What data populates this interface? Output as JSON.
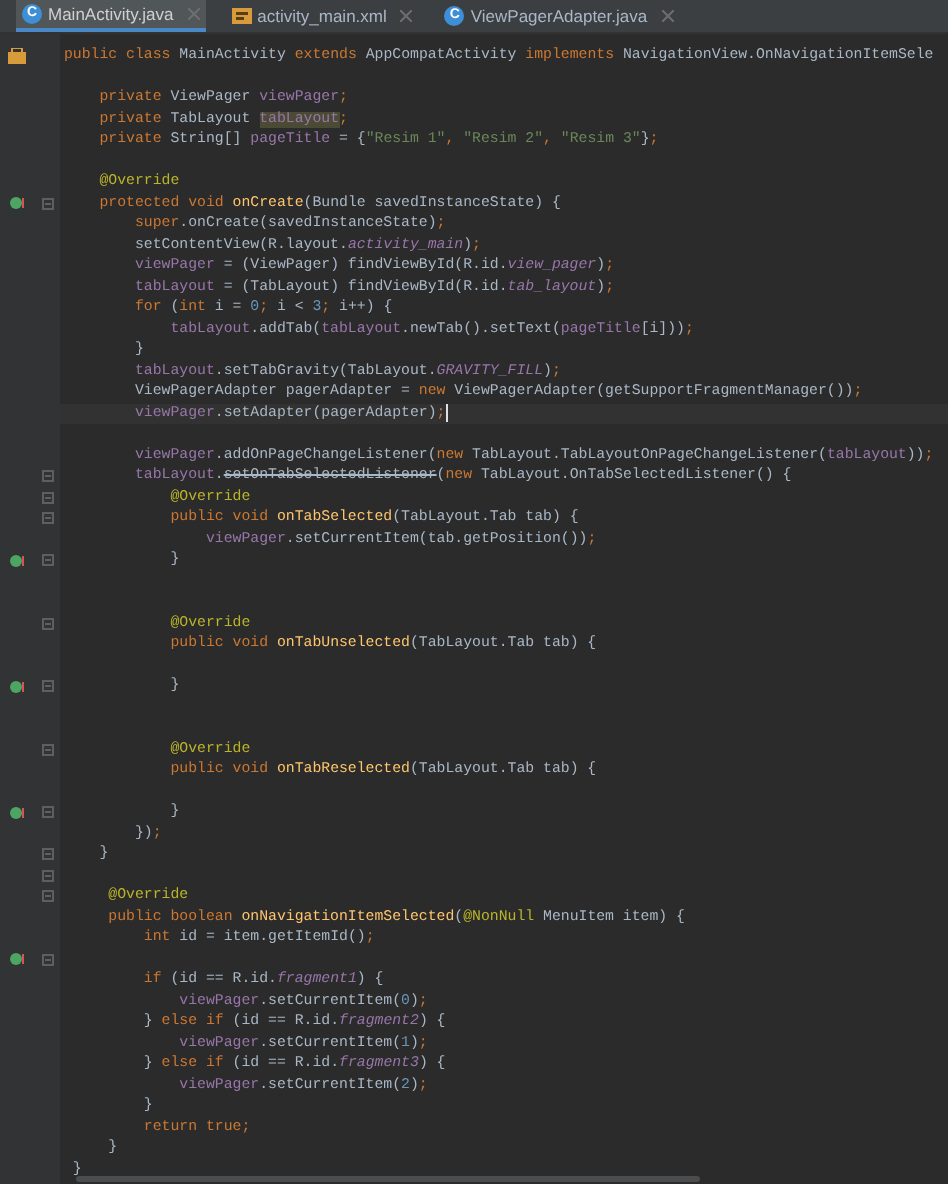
{
  "tabs": [
    {
      "label": "MainActivity.java",
      "kind": "class",
      "badge": "C",
      "selected": true
    },
    {
      "label": "activity_main.xml",
      "kind": "layout",
      "selected": false
    },
    {
      "label": "ViewPagerAdapter.java",
      "kind": "class",
      "badge": "C",
      "selected": false
    }
  ],
  "lines": [
    {
      "kind": "class",
      "tokens": [
        {
          "text": "public class ",
          "kind": "keyword"
        },
        {
          "text": "MainActivity ",
          "kind": "plain"
        },
        {
          "text": "extends ",
          "kind": "keyword"
        },
        {
          "text": "AppCompatActivity ",
          "kind": "plain"
        },
        {
          "text": "implements ",
          "kind": "keyword"
        },
        {
          "text": "NavigationView.OnNavigationItemSele",
          "kind": "plain"
        }
      ]
    },
    {
      "kind": "blank"
    },
    {
      "kind": "plain",
      "tokens": [
        {
          "text": "    private ",
          "kind": "keyword"
        },
        {
          "text": "ViewPager ",
          "kind": "plain"
        },
        {
          "text": "viewPager",
          "kind": "field"
        },
        {
          "text": ";",
          "kind": "keyword"
        }
      ]
    },
    {
      "kind": "plain",
      "tokens": [
        {
          "text": "    private ",
          "kind": "keyword"
        },
        {
          "text": "TabLayout ",
          "kind": "plain"
        },
        {
          "text": "tabLayout",
          "kind": "field_highlight"
        },
        {
          "text": ";",
          "kind": "keyword"
        }
      ]
    },
    {
      "kind": "plain",
      "tokens": [
        {
          "text": "    private ",
          "kind": "keyword"
        },
        {
          "text": "String[] ",
          "kind": "plain"
        },
        {
          "text": "pageTitle",
          "kind": "field"
        },
        {
          "text": " = {",
          "kind": "plain"
        },
        {
          "text": "\"Resim 1\"",
          "kind": "string"
        },
        {
          "text": ", ",
          "kind": "keyword"
        },
        {
          "text": "\"Resim 2\"",
          "kind": "string"
        },
        {
          "text": ", ",
          "kind": "keyword"
        },
        {
          "text": "\"Resim 3\"",
          "kind": "string"
        },
        {
          "text": "}",
          "kind": "plain"
        },
        {
          "text": ";",
          "kind": "keyword"
        }
      ]
    },
    {
      "kind": "blank"
    },
    {
      "kind": "plain",
      "tokens": [
        {
          "text": "    @Override",
          "kind": "annotation"
        }
      ]
    },
    {
      "kind": "override",
      "fold": true,
      "tokens": [
        {
          "text": "    protected void ",
          "kind": "keyword"
        },
        {
          "text": "onCreate",
          "kind": "declaration"
        },
        {
          "text": "(Bundle savedInstanceState) {",
          "kind": "plain"
        }
      ]
    },
    {
      "kind": "plain",
      "tokens": [
        {
          "text": "        super",
          "kind": "keyword"
        },
        {
          "text": ".onCreate(savedInstanceState)",
          "kind": "plain"
        },
        {
          "text": ";",
          "kind": "keyword"
        }
      ]
    },
    {
      "kind": "plain",
      "tokens": [
        {
          "text": "        setContentView(R.layout.",
          "kind": "plain"
        },
        {
          "text": "activity_main",
          "kind": "constant"
        },
        {
          "text": ")",
          "kind": "plain"
        },
        {
          "text": ";",
          "kind": "keyword"
        }
      ]
    },
    {
      "kind": "plain",
      "tokens": [
        {
          "text": "        viewPager",
          "kind": "field"
        },
        {
          "text": " = (ViewPager) findViewById(R.id.",
          "kind": "plain"
        },
        {
          "text": "view_pager",
          "kind": "constant"
        },
        {
          "text": ")",
          "kind": "plain"
        },
        {
          "text": ";",
          "kind": "keyword"
        }
      ]
    },
    {
      "kind": "plain",
      "tokens": [
        {
          "text": "        tabLayout",
          "kind": "field"
        },
        {
          "text": " = (TabLayout) findViewById(R.id.",
          "kind": "plain"
        },
        {
          "text": "tab_layout",
          "kind": "constant"
        },
        {
          "text": ")",
          "kind": "plain"
        },
        {
          "text": ";",
          "kind": "keyword"
        }
      ]
    },
    {
      "kind": "plain",
      "tokens": [
        {
          "text": "        for ",
          "kind": "keyword"
        },
        {
          "text": "(",
          "kind": "plain"
        },
        {
          "text": "int ",
          "kind": "keyword"
        },
        {
          "text": "i = ",
          "kind": "plain"
        },
        {
          "text": "0",
          "kind": "number"
        },
        {
          "text": "; ",
          "kind": "keyword"
        },
        {
          "text": "i < ",
          "kind": "plain"
        },
        {
          "text": "3",
          "kind": "number"
        },
        {
          "text": "; ",
          "kind": "keyword"
        },
        {
          "text": "i++) {",
          "kind": "plain"
        }
      ]
    },
    {
      "kind": "plain",
      "tokens": [
        {
          "text": "            tabLayout",
          "kind": "field"
        },
        {
          "text": ".addTab(",
          "kind": "plain"
        },
        {
          "text": "tabLayout",
          "kind": "field"
        },
        {
          "text": ".newTab().setText(",
          "kind": "plain"
        },
        {
          "text": "pageTitle",
          "kind": "field"
        },
        {
          "text": "[i]))",
          "kind": "plain"
        },
        {
          "text": ";",
          "kind": "keyword"
        }
      ]
    },
    {
      "kind": "plain",
      "tokens": [
        {
          "text": "        }",
          "kind": "plain"
        }
      ]
    },
    {
      "kind": "plain",
      "tokens": [
        {
          "text": "        tabLayout",
          "kind": "field"
        },
        {
          "text": ".setTabGravity(TabLayout.",
          "kind": "plain"
        },
        {
          "text": "GRAVITY_FILL",
          "kind": "constant"
        },
        {
          "text": ")",
          "kind": "plain"
        },
        {
          "text": ";",
          "kind": "keyword"
        }
      ]
    },
    {
      "kind": "plain",
      "tokens": [
        {
          "text": "        ViewPagerAdapter pagerAdapter = ",
          "kind": "plain"
        },
        {
          "text": "new ",
          "kind": "keyword"
        },
        {
          "text": "ViewPagerAdapter(getSupportFragmentManager())",
          "kind": "plain"
        },
        {
          "text": ";",
          "kind": "keyword"
        }
      ]
    },
    {
      "kind": "plain",
      "current": true,
      "tokens": [
        {
          "text": "        viewPager",
          "kind": "field"
        },
        {
          "text": ".setAdapter(pagerAdapter)",
          "kind": "plain"
        },
        {
          "text": ";",
          "kind": "keyword"
        }
      ]
    },
    {
      "kind": "blank"
    },
    {
      "kind": "plain",
      "tokens": [
        {
          "text": "        viewPager",
          "kind": "field"
        },
        {
          "text": ".addOnPageChangeListener(",
          "kind": "plain"
        },
        {
          "text": "new ",
          "kind": "keyword"
        },
        {
          "text": "TabLayout.TabLayoutOnPageChangeListener(",
          "kind": "plain"
        },
        {
          "text": "tabLayout",
          "kind": "field"
        },
        {
          "text": "))",
          "kind": "plain"
        },
        {
          "text": ";",
          "kind": "keyword"
        }
      ]
    },
    {
      "kind": "plain",
      "fold": true,
      "tokens": [
        {
          "text": "        tabLayout",
          "kind": "field"
        },
        {
          "text": ".",
          "kind": "plain"
        },
        {
          "text": "setOnTabSelectedListener",
          "kind": "deprecated"
        },
        {
          "text": "(",
          "kind": "plain"
        },
        {
          "text": "new ",
          "kind": "keyword"
        },
        {
          "text": "TabLayout.OnTabSelectedListener() {",
          "kind": "plain"
        }
      ]
    },
    {
      "kind": "plain",
      "fold": true,
      "tokens": [
        {
          "text": "            @Override",
          "kind": "annotation"
        }
      ]
    },
    {
      "kind": "plain",
      "fold": true,
      "tokens": [
        {
          "text": "            public void ",
          "kind": "keyword"
        },
        {
          "text": "onTabSelected",
          "kind": "declaration"
        },
        {
          "text": "(TabLayout.Tab tab) {",
          "kind": "plain"
        }
      ]
    },
    {
      "kind": "plain",
      "tokens": [
        {
          "text": "                viewPager",
          "kind": "field"
        },
        {
          "text": ".setCurrentItem(tab.getPosition())",
          "kind": "plain"
        },
        {
          "text": ";",
          "kind": "keyword"
        }
      ]
    },
    {
      "kind": "override",
      "fold": true,
      "tokens": [
        {
          "text": "            }",
          "kind": "plain"
        }
      ]
    },
    {
      "kind": "blank"
    },
    {
      "kind": "blank"
    },
    {
      "kind": "plain",
      "fold": true,
      "tokens": [
        {
          "text": "            @Override",
          "kind": "annotation"
        }
      ]
    },
    {
      "kind": "plain",
      "tokens": [
        {
          "text": "            public void ",
          "kind": "keyword"
        },
        {
          "text": "onTabUnselected",
          "kind": "declaration"
        },
        {
          "text": "(TabLayout.Tab tab) {",
          "kind": "plain"
        }
      ]
    },
    {
      "kind": "blank"
    },
    {
      "kind": "override",
      "fold": true,
      "tokens": [
        {
          "text": "            }",
          "kind": "plain"
        }
      ]
    },
    {
      "kind": "blank"
    },
    {
      "kind": "blank"
    },
    {
      "kind": "plain",
      "fold": true,
      "tokens": [
        {
          "text": "            @Override",
          "kind": "annotation"
        }
      ]
    },
    {
      "kind": "plain",
      "tokens": [
        {
          "text": "            public void ",
          "kind": "keyword"
        },
        {
          "text": "onTabReselected",
          "kind": "declaration"
        },
        {
          "text": "(TabLayout.Tab tab) {",
          "kind": "plain"
        }
      ]
    },
    {
      "kind": "blank"
    },
    {
      "kind": "override",
      "fold": true,
      "tokens": [
        {
          "text": "            }",
          "kind": "plain"
        }
      ]
    },
    {
      "kind": "plain",
      "tokens": [
        {
          "text": "        })",
          "kind": "plain"
        },
        {
          "text": ";",
          "kind": "keyword"
        }
      ]
    },
    {
      "kind": "plain",
      "fold": true,
      "tokens": [
        {
          "text": "    }",
          "kind": "plain"
        }
      ]
    },
    {
      "kind": "blank",
      "fold": true
    },
    {
      "kind": "plain",
      "fold": true,
      "tokens": [
        {
          "text": "     @Override",
          "kind": "annotation"
        }
      ]
    },
    {
      "kind": "plain",
      "tokens": [
        {
          "text": "     public boolean ",
          "kind": "keyword"
        },
        {
          "text": "onNavigationItemSelected",
          "kind": "declaration"
        },
        {
          "text": "(",
          "kind": "plain"
        },
        {
          "text": "@NonNull ",
          "kind": "annotation"
        },
        {
          "text": "MenuItem item) {",
          "kind": "plain"
        }
      ]
    },
    {
      "kind": "plain",
      "tokens": [
        {
          "text": "         int ",
          "kind": "keyword"
        },
        {
          "text": "id = item.getItemId()",
          "kind": "plain"
        },
        {
          "text": ";",
          "kind": "keyword"
        }
      ]
    },
    {
      "kind": "override",
      "fold": true
    },
    {
      "kind": "plain",
      "tokens": [
        {
          "text": "         if ",
          "kind": "keyword"
        },
        {
          "text": "(id == R.id.",
          "kind": "plain"
        },
        {
          "text": "fragment1",
          "kind": "constant"
        },
        {
          "text": ") {",
          "kind": "plain"
        }
      ]
    },
    {
      "kind": "plain",
      "tokens": [
        {
          "text": "             viewPager",
          "kind": "field"
        },
        {
          "text": ".setCurrentItem(",
          "kind": "plain"
        },
        {
          "text": "0",
          "kind": "number"
        },
        {
          "text": ")",
          "kind": "plain"
        },
        {
          "text": ";",
          "kind": "keyword"
        }
      ]
    },
    {
      "kind": "plain",
      "tokens": [
        {
          "text": "         } ",
          "kind": "plain"
        },
        {
          "text": "else if ",
          "kind": "keyword"
        },
        {
          "text": "(id == R.id.",
          "kind": "plain"
        },
        {
          "text": "fragment2",
          "kind": "constant"
        },
        {
          "text": ") {",
          "kind": "plain"
        }
      ]
    },
    {
      "kind": "plain",
      "tokens": [
        {
          "text": "             viewPager",
          "kind": "field"
        },
        {
          "text": ".setCurrentItem(",
          "kind": "plain"
        },
        {
          "text": "1",
          "kind": "number"
        },
        {
          "text": ")",
          "kind": "plain"
        },
        {
          "text": ";",
          "kind": "keyword"
        }
      ]
    },
    {
      "kind": "plain",
      "tokens": [
        {
          "text": "         } ",
          "kind": "plain"
        },
        {
          "text": "else if ",
          "kind": "keyword"
        },
        {
          "text": "(id == R.id.",
          "kind": "plain"
        },
        {
          "text": "fragment3",
          "kind": "constant"
        },
        {
          "text": ") {",
          "kind": "plain"
        }
      ]
    },
    {
      "kind": "plain",
      "tokens": [
        {
          "text": "             viewPager",
          "kind": "field"
        },
        {
          "text": ".setCurrentItem(",
          "kind": "plain"
        },
        {
          "text": "2",
          "kind": "number"
        },
        {
          "text": ")",
          "kind": "plain"
        },
        {
          "text": ";",
          "kind": "keyword"
        }
      ]
    },
    {
      "kind": "plain",
      "tokens": [
        {
          "text": "         }",
          "kind": "plain"
        }
      ]
    },
    {
      "kind": "plain",
      "tokens": [
        {
          "text": "         return true;",
          "kind": "keyword"
        }
      ]
    },
    {
      "kind": "plain",
      "tokens": [
        {
          "text": "     }",
          "kind": "plain"
        }
      ]
    },
    {
      "kind": "plain",
      "tokens": [
        {
          "text": " }",
          "kind": "plain"
        }
      ]
    }
  ]
}
